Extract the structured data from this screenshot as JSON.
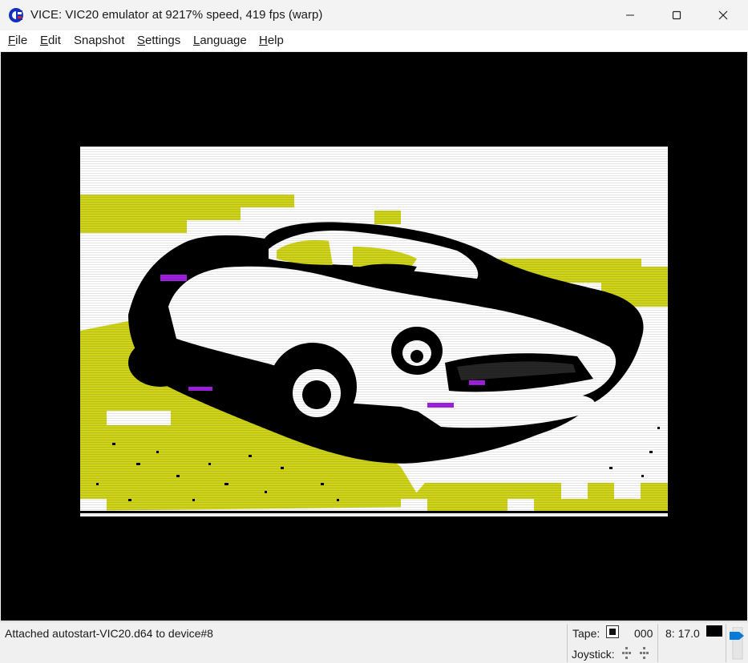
{
  "window": {
    "title": "VICE: VIC20 emulator at 9217% speed, 419 fps (warp)"
  },
  "menu": {
    "items": [
      {
        "label": "File",
        "accel": "F",
        "rest": "ile"
      },
      {
        "label": "Edit",
        "accel": "E",
        "rest": "dit"
      },
      {
        "label": "Snapshot",
        "accel": "",
        "rest": "Snapshot"
      },
      {
        "label": "Settings",
        "accel": "S",
        "rest": "ettings"
      },
      {
        "label": "Language",
        "accel": "L",
        "rest": "anguage"
      },
      {
        "label": "Help",
        "accel": "H",
        "rest": "elp"
      }
    ]
  },
  "colors": {
    "vic_white": "#ffffff",
    "vic_yellow": "#cfd41a",
    "vic_black": "#000000",
    "vic_purple": "#a020e0",
    "border": "#000000"
  },
  "status": {
    "message": "Attached autostart-VIC20.d64 to device#8",
    "tape_label": "Tape:",
    "tape_counter": "000",
    "drive_status": "8: 17.0",
    "joystick_label": "Joystick:"
  },
  "icons": {
    "app": "vice-commodore-icon",
    "minimize": "minimize-icon",
    "maximize": "maximize-icon",
    "close": "close-icon",
    "tape_stop": "tape-stop-icon",
    "volume": "volume-icon"
  }
}
